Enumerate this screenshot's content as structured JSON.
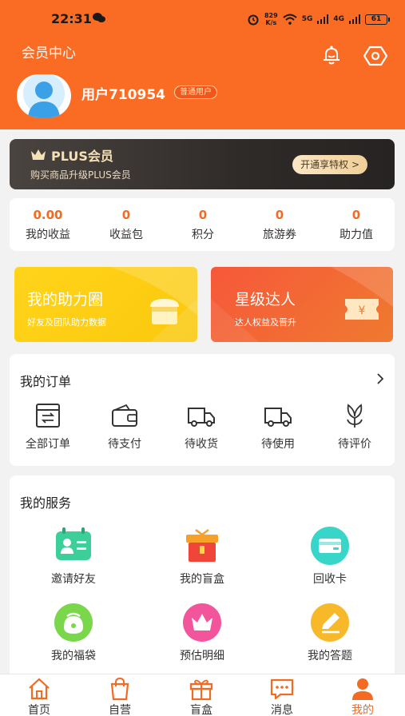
{
  "status_bar": {
    "time": "22:31",
    "net_speed_value": "829",
    "net_speed_unit": "K/s",
    "signal_1": "5G",
    "signal_2": "4G",
    "battery": "61"
  },
  "header": {
    "title": "会员中心",
    "icons": [
      "bell-icon",
      "settings-icon"
    ],
    "username": "用户710954",
    "user_badge": "普通用户"
  },
  "plus": {
    "title": "PLUS会员",
    "subtitle": "购买商品升级PLUS会员",
    "button": "开通享特权 >"
  },
  "stats": [
    {
      "value": "0.00",
      "label": "我的收益"
    },
    {
      "value": "0",
      "label": "收益包"
    },
    {
      "value": "0",
      "label": "积分"
    },
    {
      "value": "0",
      "label": "旅游券"
    },
    {
      "value": "0",
      "label": "助力值"
    }
  ],
  "promos": [
    {
      "title": "我的助力圈",
      "subtitle": "好友及团队助力数据"
    },
    {
      "title": "星级达人",
      "subtitle": "达人权益及晋升"
    }
  ],
  "orders": {
    "title": "我的订单",
    "items": [
      {
        "label": "全部订单",
        "icon": "all-orders-icon"
      },
      {
        "label": "待支付",
        "icon": "wallet-icon"
      },
      {
        "label": "待收货",
        "icon": "truck-icon"
      },
      {
        "label": "待使用",
        "icon": "truck-icon"
      },
      {
        "label": "待评价",
        "icon": "flower-icon"
      }
    ]
  },
  "services": {
    "title": "我的服务",
    "items": [
      {
        "label": "邀请好友",
        "icon": "contact-card-icon",
        "color": "#3ccf9a"
      },
      {
        "label": "我的盲盒",
        "icon": "gift-box-icon",
        "color": "#f0463a"
      },
      {
        "label": "回收卡",
        "icon": "card-icon",
        "color": "#37d6c9"
      },
      {
        "label": "我的福袋",
        "icon": "lucky-bag-icon",
        "color": "#7ad64a"
      },
      {
        "label": "预估明细",
        "icon": "crown-icon",
        "color": "#f2559b"
      },
      {
        "label": "我的答题",
        "icon": "pencil-icon",
        "color": "#f7b92a"
      }
    ]
  },
  "tabbar": {
    "items": [
      {
        "label": "首页",
        "icon": "home-icon"
      },
      {
        "label": "自营",
        "icon": "shopping-bag-icon"
      },
      {
        "label": "盲盒",
        "icon": "gift-icon"
      },
      {
        "label": "消息",
        "icon": "message-icon"
      },
      {
        "label": "我的",
        "icon": "person-icon"
      }
    ],
    "active": "我的"
  },
  "colors": {
    "brand": "#fa6b24",
    "accent_text": "#f36a22"
  }
}
